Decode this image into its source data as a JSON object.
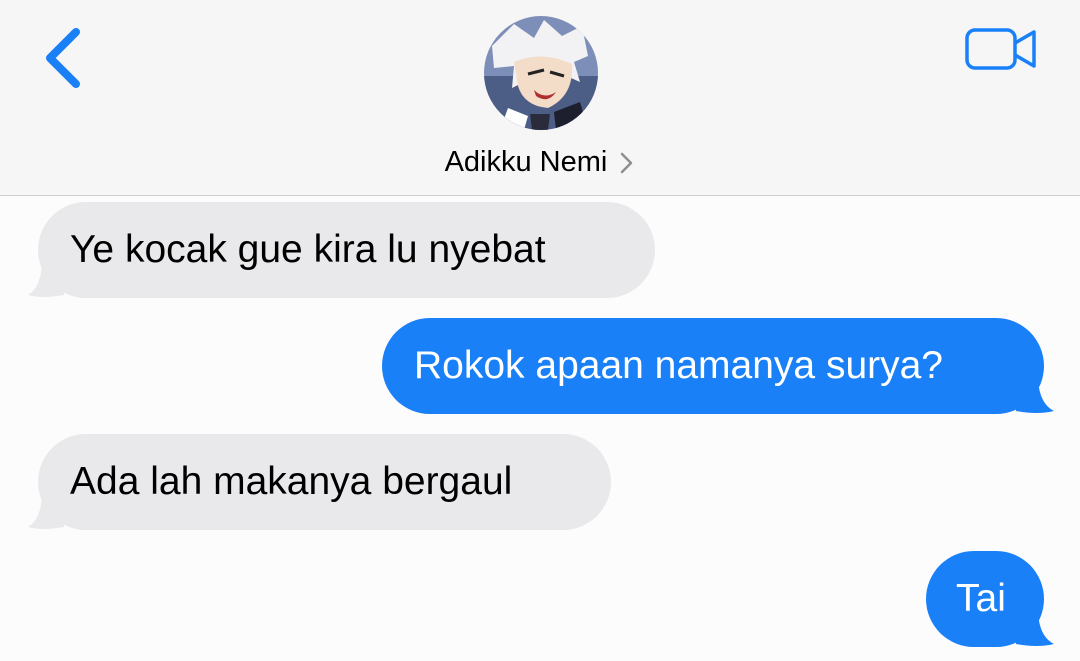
{
  "header": {
    "contact_name": "Adikku Nemi",
    "back_icon": "chevron-left-icon",
    "video_icon": "video-camera-icon",
    "disclosure_icon": "chevron-right-icon",
    "accent_color": "#1a80f7"
  },
  "messages": [
    {
      "direction": "incoming",
      "text": "Ye kocak gue kira lu nyebat"
    },
    {
      "direction": "outgoing",
      "text": "Rokok apaan namanya surya?"
    },
    {
      "direction": "incoming",
      "text": "Ada lah makanya bergaul"
    },
    {
      "direction": "outgoing",
      "text": "Tai"
    }
  ],
  "colors": {
    "incoming_bubble": "#e9e9eb",
    "outgoing_bubble": "#1a80f7",
    "header_background": "#f6f6f6"
  }
}
